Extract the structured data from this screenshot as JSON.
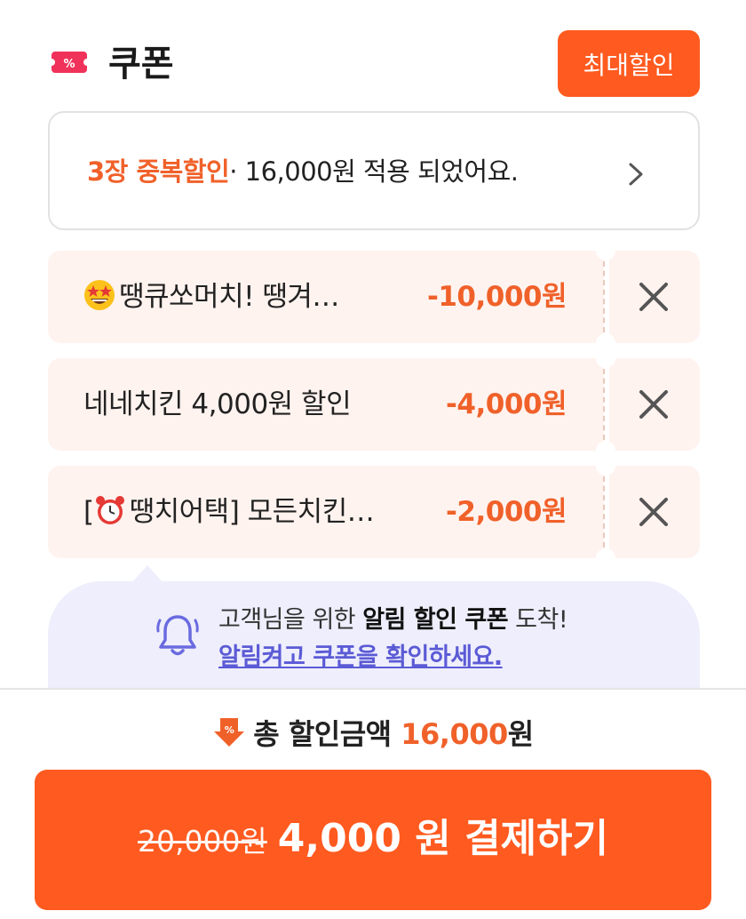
{
  "header": {
    "title": "쿠폰",
    "ticket_icon": "coupon-ticket-icon",
    "max_discount_button": "최대할인"
  },
  "summary": {
    "accent_text": "3장 중복할인",
    "rest_text": "· 16,000원 적용 되었어요.",
    "chevron_icon": "chevron-right-icon"
  },
  "coupons": [
    {
      "emoji": "star-struck-face-icon",
      "name": "땡큐쏘머치! 땡겨…",
      "amount": "-10,000원"
    },
    {
      "emoji": "",
      "name": "네네치킨 4,000원 할인",
      "amount": "-4,000원"
    },
    {
      "prefix": "[",
      "emoji": "alarm-clock-icon",
      "name": "땡치어택] 모든치킨…",
      "amount": "-2,000원"
    }
  ],
  "notice": {
    "line1_prefix": "고객님을 위한 ",
    "line1_bold": "알림 할인 쿠폰",
    "line1_suffix": " 도착!",
    "line2_link": "알림켜고 쿠폰을 확인하세요."
  },
  "footer": {
    "total_label": "총 할인금액 ",
    "total_amount": "16,000",
    "total_unit": "원",
    "original_price": "20,000원",
    "pay_label": "4,000 원 결제하기"
  },
  "colors": {
    "accent": "#ff5a1f",
    "accent_text": "#f0612a",
    "coupon_bg": "#fff3ef",
    "notice_bg": "#eeeefc",
    "link": "#5b5bd6"
  }
}
